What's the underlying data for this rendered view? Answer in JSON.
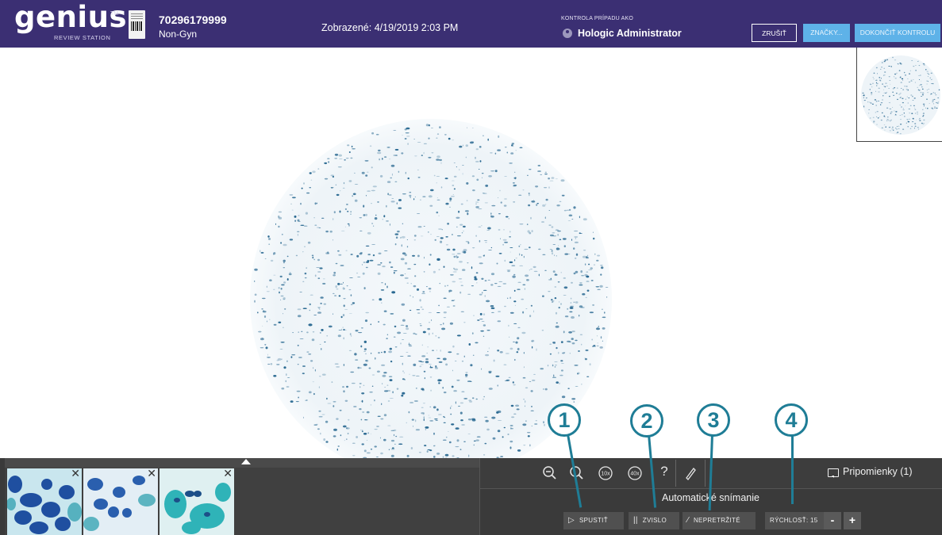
{
  "header": {
    "logo_word": "genius",
    "logo_tm": "TM",
    "logo_subtitle": "REVIEW STATION",
    "case_id": "70296179999",
    "case_type": "Non-Gyn",
    "viewed": "Zobrazené: 4/19/2019 2:03 PM",
    "review_label": "KONTROLA PRÍPADU AKO",
    "user_name": "Hologic Administrator",
    "buttons": {
      "cancel": "ZRUŠIŤ",
      "marks": "ZNAČKY...",
      "finish": "DOKONČIŤ KONTROLU"
    }
  },
  "toolbar": {
    "icons": [
      "zoom-out-icon",
      "zoom-fit-icon",
      "zoom-10x-icon",
      "zoom-40x-icon",
      "help-icon",
      "pen-icon"
    ],
    "zoom10": "10x",
    "zoom40": "40x",
    "help": "?",
    "comments": "Pripomienky (1)"
  },
  "autoscan": {
    "title": "Automatické snímanie",
    "start": "SPUSTIŤ",
    "vertical": "ZVISLO",
    "continuous": "NEPRETRŽITÉ",
    "speed_label": "RÝCHLOSŤ: 15",
    "speed_value": 15,
    "minus": "-",
    "plus": "+"
  },
  "thumbnails": [
    {
      "close": "✕"
    },
    {
      "close": "✕"
    },
    {
      "close": "✕"
    }
  ],
  "callouts": [
    "1",
    "2",
    "3",
    "4"
  ],
  "colors": {
    "header": "#3b2f73",
    "accent_button": "#5eb2e8",
    "callout": "#1f7d96",
    "panel": "#3a3a3a",
    "cell_stain": "#1c5f8a"
  }
}
